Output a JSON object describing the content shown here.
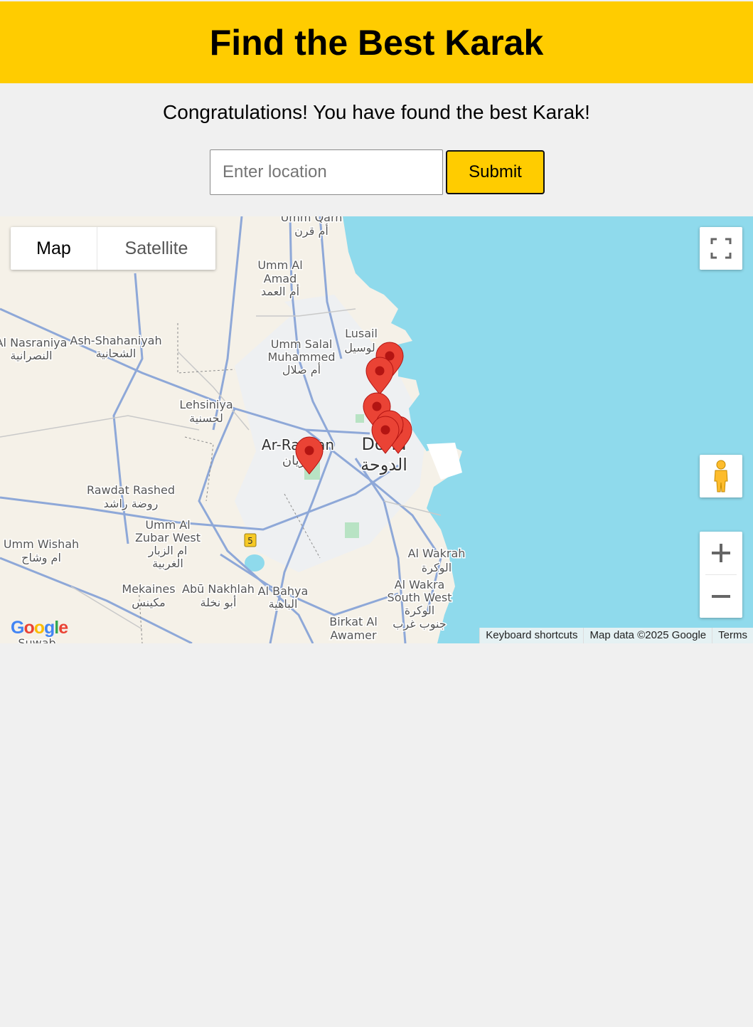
{
  "header": {
    "title": "Find the Best Karak"
  },
  "message": "Congratulations! You have found the best Karak!",
  "search": {
    "placeholder": "Enter location",
    "value": ""
  },
  "submit_label": "Submit",
  "map": {
    "type_control": {
      "map_label": "Map",
      "satellite_label": "Satellite",
      "selected": "Map"
    },
    "labels": {
      "umm_qarn": "Umm Qarn",
      "umm_qarn_ar": "أم قرن",
      "umm_al_amad": "Umm Al",
      "umm_al_amad2": "Amad",
      "umm_al_amad_ar": "أم العمد",
      "lusail": "Lusail",
      "lusail_ar": "لوسيل",
      "umm_salal": "Umm Salal",
      "umm_salal2": "Muhammed",
      "umm_salal_ar": "أم صلال",
      "al_nasraniya": "Al Nasraniya",
      "al_nasraniya_ar": "النصرانية",
      "ash_shahaniyah": "Ash-Shahaniyah",
      "ash_shahaniyah_ar": "الشحانية",
      "lehsiniya": "Lehsiniya",
      "lehsiniya_ar": "لحسنية",
      "ar_rayyan": "Ar-Rayyan",
      "ar_rayyan_ar": "الريان",
      "doha": "Doha",
      "doha_ar": "الدوحة",
      "rawdat_rashed": "Rawdat Rashed",
      "rawdat_rashed_ar": "روضة راشد",
      "umm_al_zubar": "Umm Al",
      "umm_al_zubar2": "Zubar West",
      "umm_al_zubar_ar": "ام الزبار",
      "umm_al_zubar_ar2": "الغربية",
      "umm_wishah": "Umm Wishah",
      "umm_wishah_ar": "ام وشاح",
      "al_wakrah": "Al Wakrah",
      "al_wakrah_ar": "الوكرة",
      "al_wakra_sw": "Al Wakra",
      "al_wakra_sw2": "South West",
      "al_wakra_sw_ar": "الوكرة",
      "al_wakra_sw_ar2": "جنوب غرب",
      "mekaines": "Mekaines",
      "mekaines_ar": "مكينس",
      "abu_nakhlah": "Abū Nakhlah",
      "abu_nakhlah_ar": "أبو نخلة",
      "al_bahya": "Al Bahya",
      "al_bahya_ar": "الباهية",
      "birkat": "Birkat Al",
      "birkat2": "Awamer",
      "suwab": "Suwab",
      "road_5": "5"
    },
    "marker_count": 7,
    "logo": "Google",
    "attribution": {
      "shortcuts": "Keyboard shortcuts",
      "data": "Map data ©2025 Google",
      "terms": "Terms"
    },
    "colors": {
      "water": "#8fdaec",
      "land": "#f5f1e8",
      "urban": "#eef0f2",
      "road": "#8ea8d8",
      "marker": "#ea4335"
    }
  },
  "colors": {
    "header_bg": "#ffcc00",
    "page_bg": "#f0f0f0"
  }
}
